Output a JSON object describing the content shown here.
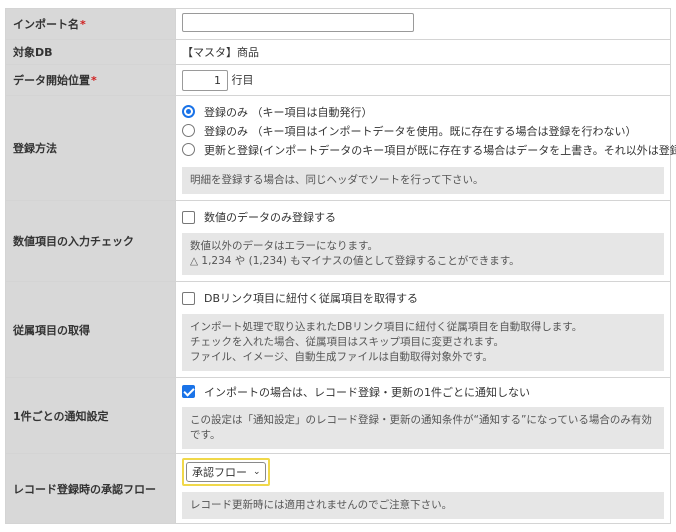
{
  "fields": {
    "import_name": {
      "label": "インポート名",
      "required_mark": "*"
    },
    "target_db": {
      "label": "対象DB",
      "value": "【マスタ】商品"
    },
    "start_row": {
      "label": "データ開始位置",
      "required_mark": "*",
      "value": "1",
      "unit": "行目"
    },
    "register_method": {
      "label": "登録方法",
      "options": [
        "登録のみ （キー項目は自動発行）",
        "登録のみ （キー項目はインポートデータを使用。既に存在する場合は登録を行わない）",
        "更新と登録(インポートデータのキー項目が既に存在する場合はデータを上書き。それ以外は登録)"
      ],
      "selected_index": 0,
      "note": "明細を登録する場合は、同じヘッダでソートを行って下さい。"
    },
    "numeric_check": {
      "label": "数値項目の入力チェック",
      "checkbox_label": "数値のデータのみ登録する",
      "checked": false,
      "note_lines": [
        "数値以外のデータはエラーになります。",
        "△ 1,234 や (1,234) もマイナスの値として登録することができます。"
      ]
    },
    "dependent_items": {
      "label": "従属項目の取得",
      "checkbox_label": "DBリンク項目に紐付く従属項目を取得する",
      "checked": false,
      "note_lines": [
        "インポート処理で取り込まれたDBリンク項目に紐付く従属項目を自動取得します。",
        "チェックを入れた場合、従属項目はスキップ項目に変更されます。",
        "ファイル、イメージ、自動生成ファイルは自動取得対象外です。"
      ]
    },
    "notification": {
      "label": "1件ごとの通知設定",
      "checkbox_label": "インポートの場合は、レコード登録・更新の1件ごとに通知しない",
      "checked": true,
      "note": "この設定は「通知設定」のレコード登録・更新の通知条件が“通知する”になっている場合のみ有効です。"
    },
    "approval_flow": {
      "label": "レコード登録時の承認フロー",
      "select_value": "承認フロー",
      "note": "レコード更新時には適用されませんのでご注意下さい。"
    }
  }
}
